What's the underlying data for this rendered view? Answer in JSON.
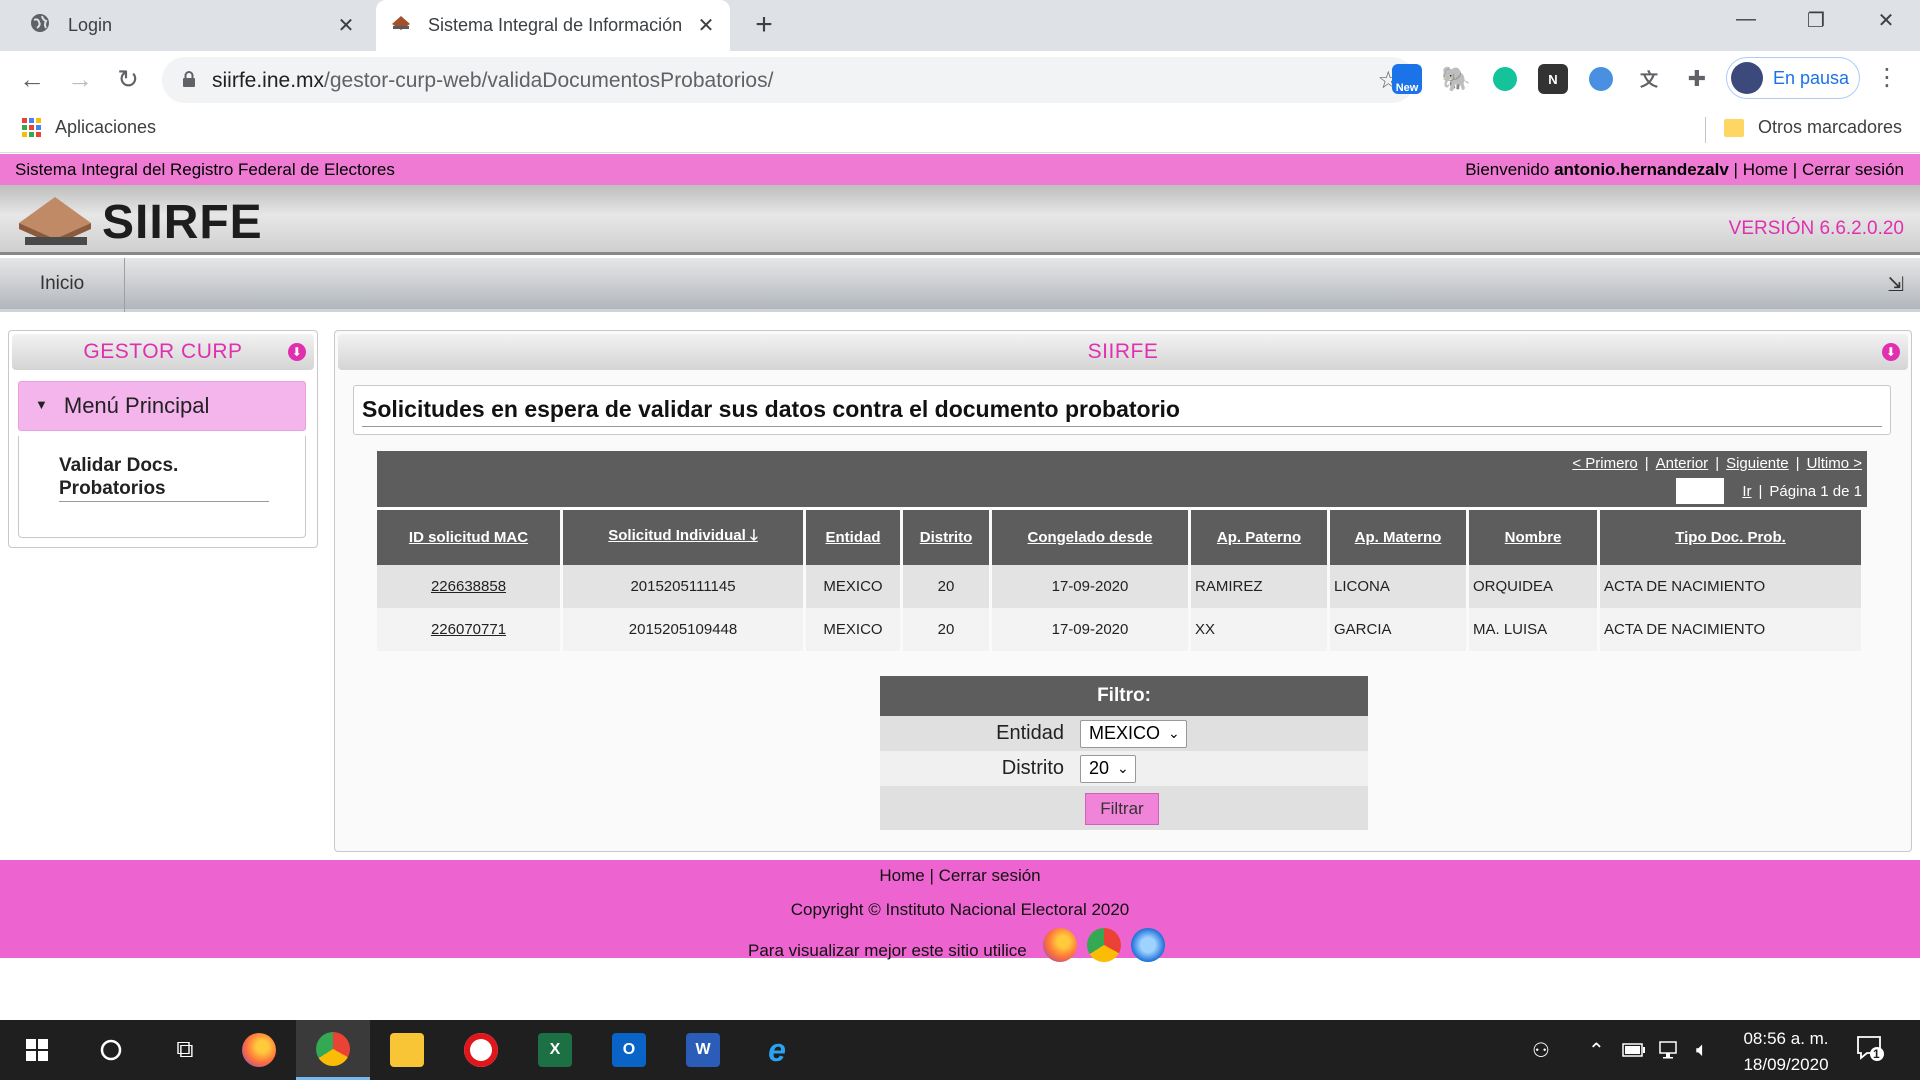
{
  "browser": {
    "tabs": [
      {
        "title": "Login"
      },
      {
        "title": "Sistema Integral de Información"
      }
    ],
    "url_host": "siirfe.ine.mx",
    "url_path": "/gestor-curp-web/validaDocumentosProbatorios/",
    "profile_label": "En pausa",
    "ext_new_label": "New",
    "bookmarks": {
      "apps": "Aplicaciones",
      "other": "Otros marcadores"
    }
  },
  "site": {
    "system_name": "Sistema Integral del Registro Federal de Electores",
    "welcome_prefix": "Bienvenido",
    "username": "antonio.hernandezalv",
    "home_link": "Home",
    "logout_link": "Cerrar sesión",
    "logo_text": "SIIRFE",
    "version": "VERSIÓN 6.6.2.0.20",
    "menu_inicio": "Inicio"
  },
  "sidebar": {
    "title": "GESTOR CURP",
    "menu_principal": "Menú Principal",
    "items": [
      {
        "label": "Validar Docs. Probatorios"
      }
    ]
  },
  "main": {
    "panel_title": "SIIRFE",
    "page_title": "Solicitudes en espera de validar sus datos contra el documento probatorio",
    "pager": {
      "first": "< Primero",
      "prev": "Anterior",
      "next": "Siguiente",
      "last": "Ultimo >",
      "go": "Ir",
      "page_info": "Página 1 de 1"
    },
    "columns": [
      "ID solicitud MAC",
      "Solicitud Individual",
      "Entidad",
      "Distrito",
      "Congelado desde",
      "Ap. Paterno",
      "Ap. Materno",
      "Nombre",
      "Tipo Doc. Prob."
    ],
    "sort_indicator": "🡓",
    "rows": [
      {
        "id_mac": "226638858",
        "solicitud": "2015205111145",
        "entidad": "MEXICO",
        "distrito": "20",
        "congelado": "17-09-2020",
        "ap_paterno": "RAMIREZ",
        "ap_materno": "LICONA",
        "nombre": "ORQUIDEA",
        "tipo_doc": "ACTA DE NACIMIENTO"
      },
      {
        "id_mac": "226070771",
        "solicitud": "2015205109448",
        "entidad": "MEXICO",
        "distrito": "20",
        "congelado": "17-09-2020",
        "ap_paterno": "XX",
        "ap_materno": "GARCIA",
        "nombre": "MA. LUISA",
        "tipo_doc": "ACTA DE NACIMIENTO"
      }
    ],
    "filter": {
      "title": "Filtro:",
      "entidad_label": "Entidad",
      "entidad_value": "MEXICO",
      "distrito_label": "Distrito",
      "distrito_value": "20",
      "button": "Filtrar"
    }
  },
  "footer": {
    "home": "Home",
    "separator": "|",
    "logout": "Cerrar sesión",
    "copyright": "Copyright ©  Instituto Nacional Electoral 2020",
    "browsers_text": "Para visualizar mejor este sitio utilice"
  },
  "taskbar": {
    "time": "08:56 a. m.",
    "date": "18/09/2020",
    "notifications": "1"
  },
  "colors": {
    "site_pink": "#ee7ad4",
    "footer_pink": "#ed63cf",
    "accent_magenta": "#e030b0",
    "table_header": "#5d5d5d"
  }
}
